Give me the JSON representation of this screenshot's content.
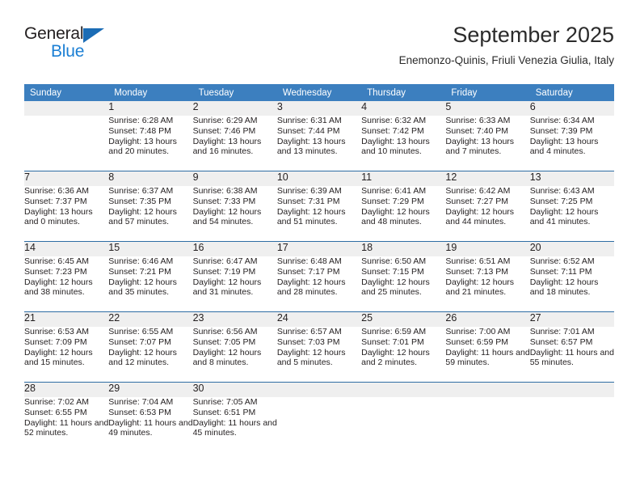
{
  "brand": {
    "name_top": "General",
    "name_bottom": "Blue",
    "triangle_color": "#1b6cb5",
    "blue_color": "#1b7fd4"
  },
  "header": {
    "title": "September 2025",
    "subtitle": "Enemonzo-Quinis, Friuli Venezia Giulia, Italy"
  },
  "theme": {
    "header_band": "#3c7fbf",
    "row_divider": "#2e6da4",
    "daynum_band": "#efefef",
    "text": "#231f20"
  },
  "weekdays": [
    "Sunday",
    "Monday",
    "Tuesday",
    "Wednesday",
    "Thursday",
    "Friday",
    "Saturday"
  ],
  "labels": {
    "sunrise": "Sunrise:",
    "sunset": "Sunset:",
    "daylight": "Daylight:"
  },
  "weeks": [
    {
      "days": [
        {
          "num": "",
          "sunrise": "",
          "sunset": "",
          "daylight": ""
        },
        {
          "num": "1",
          "sunrise": "Sunrise: 6:28 AM",
          "sunset": "Sunset: 7:48 PM",
          "daylight": "Daylight: 13 hours and 20 minutes."
        },
        {
          "num": "2",
          "sunrise": "Sunrise: 6:29 AM",
          "sunset": "Sunset: 7:46 PM",
          "daylight": "Daylight: 13 hours and 16 minutes."
        },
        {
          "num": "3",
          "sunrise": "Sunrise: 6:31 AM",
          "sunset": "Sunset: 7:44 PM",
          "daylight": "Daylight: 13 hours and 13 minutes."
        },
        {
          "num": "4",
          "sunrise": "Sunrise: 6:32 AM",
          "sunset": "Sunset: 7:42 PM",
          "daylight": "Daylight: 13 hours and 10 minutes."
        },
        {
          "num": "5",
          "sunrise": "Sunrise: 6:33 AM",
          "sunset": "Sunset: 7:40 PM",
          "daylight": "Daylight: 13 hours and 7 minutes."
        },
        {
          "num": "6",
          "sunrise": "Sunrise: 6:34 AM",
          "sunset": "Sunset: 7:39 PM",
          "daylight": "Daylight: 13 hours and 4 minutes."
        }
      ]
    },
    {
      "days": [
        {
          "num": "7",
          "sunrise": "Sunrise: 6:36 AM",
          "sunset": "Sunset: 7:37 PM",
          "daylight": "Daylight: 13 hours and 0 minutes."
        },
        {
          "num": "8",
          "sunrise": "Sunrise: 6:37 AM",
          "sunset": "Sunset: 7:35 PM",
          "daylight": "Daylight: 12 hours and 57 minutes."
        },
        {
          "num": "9",
          "sunrise": "Sunrise: 6:38 AM",
          "sunset": "Sunset: 7:33 PM",
          "daylight": "Daylight: 12 hours and 54 minutes."
        },
        {
          "num": "10",
          "sunrise": "Sunrise: 6:39 AM",
          "sunset": "Sunset: 7:31 PM",
          "daylight": "Daylight: 12 hours and 51 minutes."
        },
        {
          "num": "11",
          "sunrise": "Sunrise: 6:41 AM",
          "sunset": "Sunset: 7:29 PM",
          "daylight": "Daylight: 12 hours and 48 minutes."
        },
        {
          "num": "12",
          "sunrise": "Sunrise: 6:42 AM",
          "sunset": "Sunset: 7:27 PM",
          "daylight": "Daylight: 12 hours and 44 minutes."
        },
        {
          "num": "13",
          "sunrise": "Sunrise: 6:43 AM",
          "sunset": "Sunset: 7:25 PM",
          "daylight": "Daylight: 12 hours and 41 minutes."
        }
      ]
    },
    {
      "days": [
        {
          "num": "14",
          "sunrise": "Sunrise: 6:45 AM",
          "sunset": "Sunset: 7:23 PM",
          "daylight": "Daylight: 12 hours and 38 minutes."
        },
        {
          "num": "15",
          "sunrise": "Sunrise: 6:46 AM",
          "sunset": "Sunset: 7:21 PM",
          "daylight": "Daylight: 12 hours and 35 minutes."
        },
        {
          "num": "16",
          "sunrise": "Sunrise: 6:47 AM",
          "sunset": "Sunset: 7:19 PM",
          "daylight": "Daylight: 12 hours and 31 minutes."
        },
        {
          "num": "17",
          "sunrise": "Sunrise: 6:48 AM",
          "sunset": "Sunset: 7:17 PM",
          "daylight": "Daylight: 12 hours and 28 minutes."
        },
        {
          "num": "18",
          "sunrise": "Sunrise: 6:50 AM",
          "sunset": "Sunset: 7:15 PM",
          "daylight": "Daylight: 12 hours and 25 minutes."
        },
        {
          "num": "19",
          "sunrise": "Sunrise: 6:51 AM",
          "sunset": "Sunset: 7:13 PM",
          "daylight": "Daylight: 12 hours and 21 minutes."
        },
        {
          "num": "20",
          "sunrise": "Sunrise: 6:52 AM",
          "sunset": "Sunset: 7:11 PM",
          "daylight": "Daylight: 12 hours and 18 minutes."
        }
      ]
    },
    {
      "days": [
        {
          "num": "21",
          "sunrise": "Sunrise: 6:53 AM",
          "sunset": "Sunset: 7:09 PM",
          "daylight": "Daylight: 12 hours and 15 minutes."
        },
        {
          "num": "22",
          "sunrise": "Sunrise: 6:55 AM",
          "sunset": "Sunset: 7:07 PM",
          "daylight": "Daylight: 12 hours and 12 minutes."
        },
        {
          "num": "23",
          "sunrise": "Sunrise: 6:56 AM",
          "sunset": "Sunset: 7:05 PM",
          "daylight": "Daylight: 12 hours and 8 minutes."
        },
        {
          "num": "24",
          "sunrise": "Sunrise: 6:57 AM",
          "sunset": "Sunset: 7:03 PM",
          "daylight": "Daylight: 12 hours and 5 minutes."
        },
        {
          "num": "25",
          "sunrise": "Sunrise: 6:59 AM",
          "sunset": "Sunset: 7:01 PM",
          "daylight": "Daylight: 12 hours and 2 minutes."
        },
        {
          "num": "26",
          "sunrise": "Sunrise: 7:00 AM",
          "sunset": "Sunset: 6:59 PM",
          "daylight": "Daylight: 11 hours and 59 minutes."
        },
        {
          "num": "27",
          "sunrise": "Sunrise: 7:01 AM",
          "sunset": "Sunset: 6:57 PM",
          "daylight": "Daylight: 11 hours and 55 minutes."
        }
      ]
    },
    {
      "days": [
        {
          "num": "28",
          "sunrise": "Sunrise: 7:02 AM",
          "sunset": "Sunset: 6:55 PM",
          "daylight": "Daylight: 11 hours and 52 minutes."
        },
        {
          "num": "29",
          "sunrise": "Sunrise: 7:04 AM",
          "sunset": "Sunset: 6:53 PM",
          "daylight": "Daylight: 11 hours and 49 minutes."
        },
        {
          "num": "30",
          "sunrise": "Sunrise: 7:05 AM",
          "sunset": "Sunset: 6:51 PM",
          "daylight": "Daylight: 11 hours and 45 minutes."
        },
        {
          "num": "",
          "sunrise": "",
          "sunset": "",
          "daylight": ""
        },
        {
          "num": "",
          "sunrise": "",
          "sunset": "",
          "daylight": ""
        },
        {
          "num": "",
          "sunrise": "",
          "sunset": "",
          "daylight": ""
        },
        {
          "num": "",
          "sunrise": "",
          "sunset": "",
          "daylight": ""
        }
      ]
    }
  ]
}
